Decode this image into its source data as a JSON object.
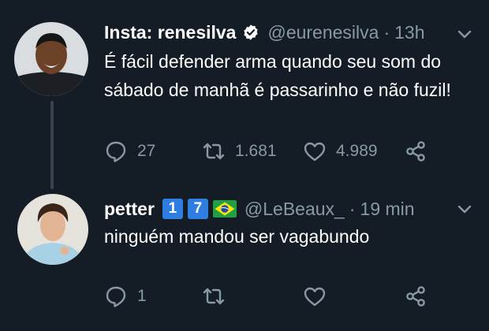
{
  "colors": {
    "background": "#141d26",
    "text": "#ffffff",
    "muted": "#8899a6",
    "verified": "#ffffff",
    "badge": "#2f7de1",
    "thread_line": "#38444d"
  },
  "tweets": [
    {
      "display_name": "Insta: renesilva",
      "verified": true,
      "handle": "@eurenesilva",
      "separator": "·",
      "time": "13h",
      "text": "É fácil defender arma quando seu som do sábado de manhã é passarinho e não fuzil!",
      "reply_count": "27",
      "retweet_count": "1.681",
      "like_count": "4.989",
      "icons": [
        "avatar",
        "verified-icon",
        "chevron-down-icon",
        "reply-icon",
        "retweet-icon",
        "like-icon",
        "share-icon"
      ]
    },
    {
      "display_name": "petter",
      "badges": [
        "1",
        "7"
      ],
      "flag": "brazil-flag-icon",
      "handle": "@LeBeaux_",
      "separator": "·",
      "time": "19 min",
      "text": "ninguém mandou ser vagabundo",
      "reply_count": "1",
      "retweet_count": "",
      "like_count": "",
      "icons": [
        "avatar",
        "chevron-down-icon",
        "reply-icon",
        "retweet-icon",
        "like-icon",
        "share-icon"
      ]
    }
  ]
}
